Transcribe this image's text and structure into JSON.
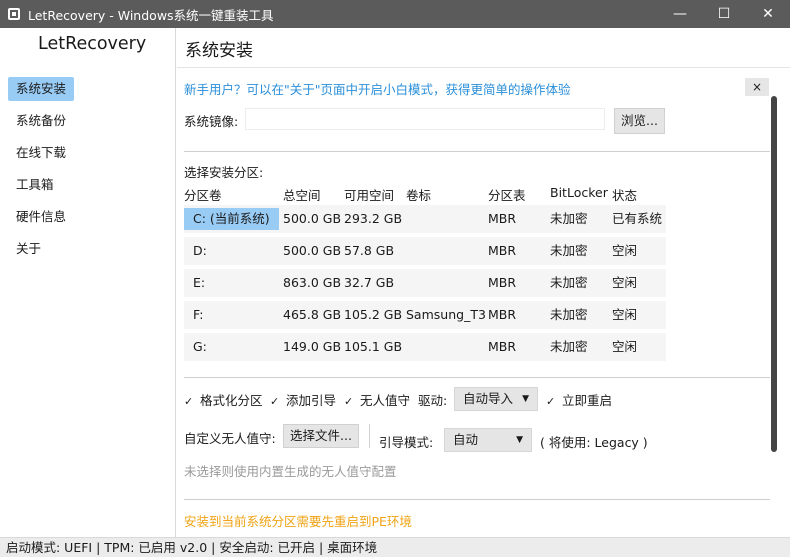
{
  "window": {
    "title": "LetRecovery - Windows系统一键重装工具",
    "controls": [
      "—",
      "☐",
      "✕"
    ]
  },
  "sidebar": {
    "app_name": "LetRecovery",
    "items": [
      {
        "label": "系统安装",
        "active": true
      },
      {
        "label": "系统备份",
        "active": false
      },
      {
        "label": "在线下载",
        "active": false
      },
      {
        "label": "工具箱",
        "active": false
      },
      {
        "label": "硬件信息",
        "active": false
      },
      {
        "label": "关于",
        "active": false
      }
    ]
  },
  "main": {
    "title": "系统安装",
    "tip": "新手用户？可以在\"关于\"页面中开启小白模式，获得更简单的操作体验",
    "close_tip": "×",
    "image_label": "系统镜像:",
    "image_value": "",
    "browse_label": "浏览...",
    "partition_label": "选择安装分区:",
    "table": {
      "headers": [
        "分区卷",
        "总空间",
        "可用空间",
        "卷标",
        "分区表",
        "BitLocker",
        "状态"
      ],
      "rows": [
        [
          "C: (当前系统)",
          "500.0 GB",
          "293.2 GB",
          "",
          "MBR",
          "未加密",
          "已有系统"
        ],
        [
          "D:",
          "500.0 GB",
          "57.8 GB",
          "",
          "MBR",
          "未加密",
          "空闲"
        ],
        [
          "E:",
          "863.0 GB",
          "32.7 GB",
          "",
          "MBR",
          "未加密",
          "空闲"
        ],
        [
          "F:",
          "465.8 GB",
          "105.2 GB",
          "Samsung_T3",
          "MBR",
          "未加密",
          "空闲"
        ],
        [
          "G:",
          "149.0 GB",
          "105.1 GB",
          "",
          "MBR",
          "未加密",
          "空闲"
        ]
      ]
    },
    "options": {
      "check_mark": "✓",
      "format": "格式化分区",
      "add_boot": "添加引导",
      "unattended": "无人值守",
      "driver_label": "驱动:",
      "driver_value": "自动导入",
      "reboot": "立即重启",
      "arrow": "▼"
    },
    "unattend_label": "自定义无人值守:",
    "choose_file": "选择文件...",
    "boot_mode_label": "引导模式:",
    "boot_mode_value": "自动",
    "boot_mode_note": "( 将使用: Legacy )",
    "hint": "未选择则使用内置生成的无人值守配置",
    "warning": "安装到当前系统分区需要先重启到PE环境"
  },
  "status_bar": "启动模式: UEFI | TPM: 已启用 v2.0 | 安全启动: 已开启 | 桌面环境",
  "colors": {
    "accent": "#99ccf5",
    "tip_blue": "#2b8fd9",
    "warning": "#f0a315"
  }
}
